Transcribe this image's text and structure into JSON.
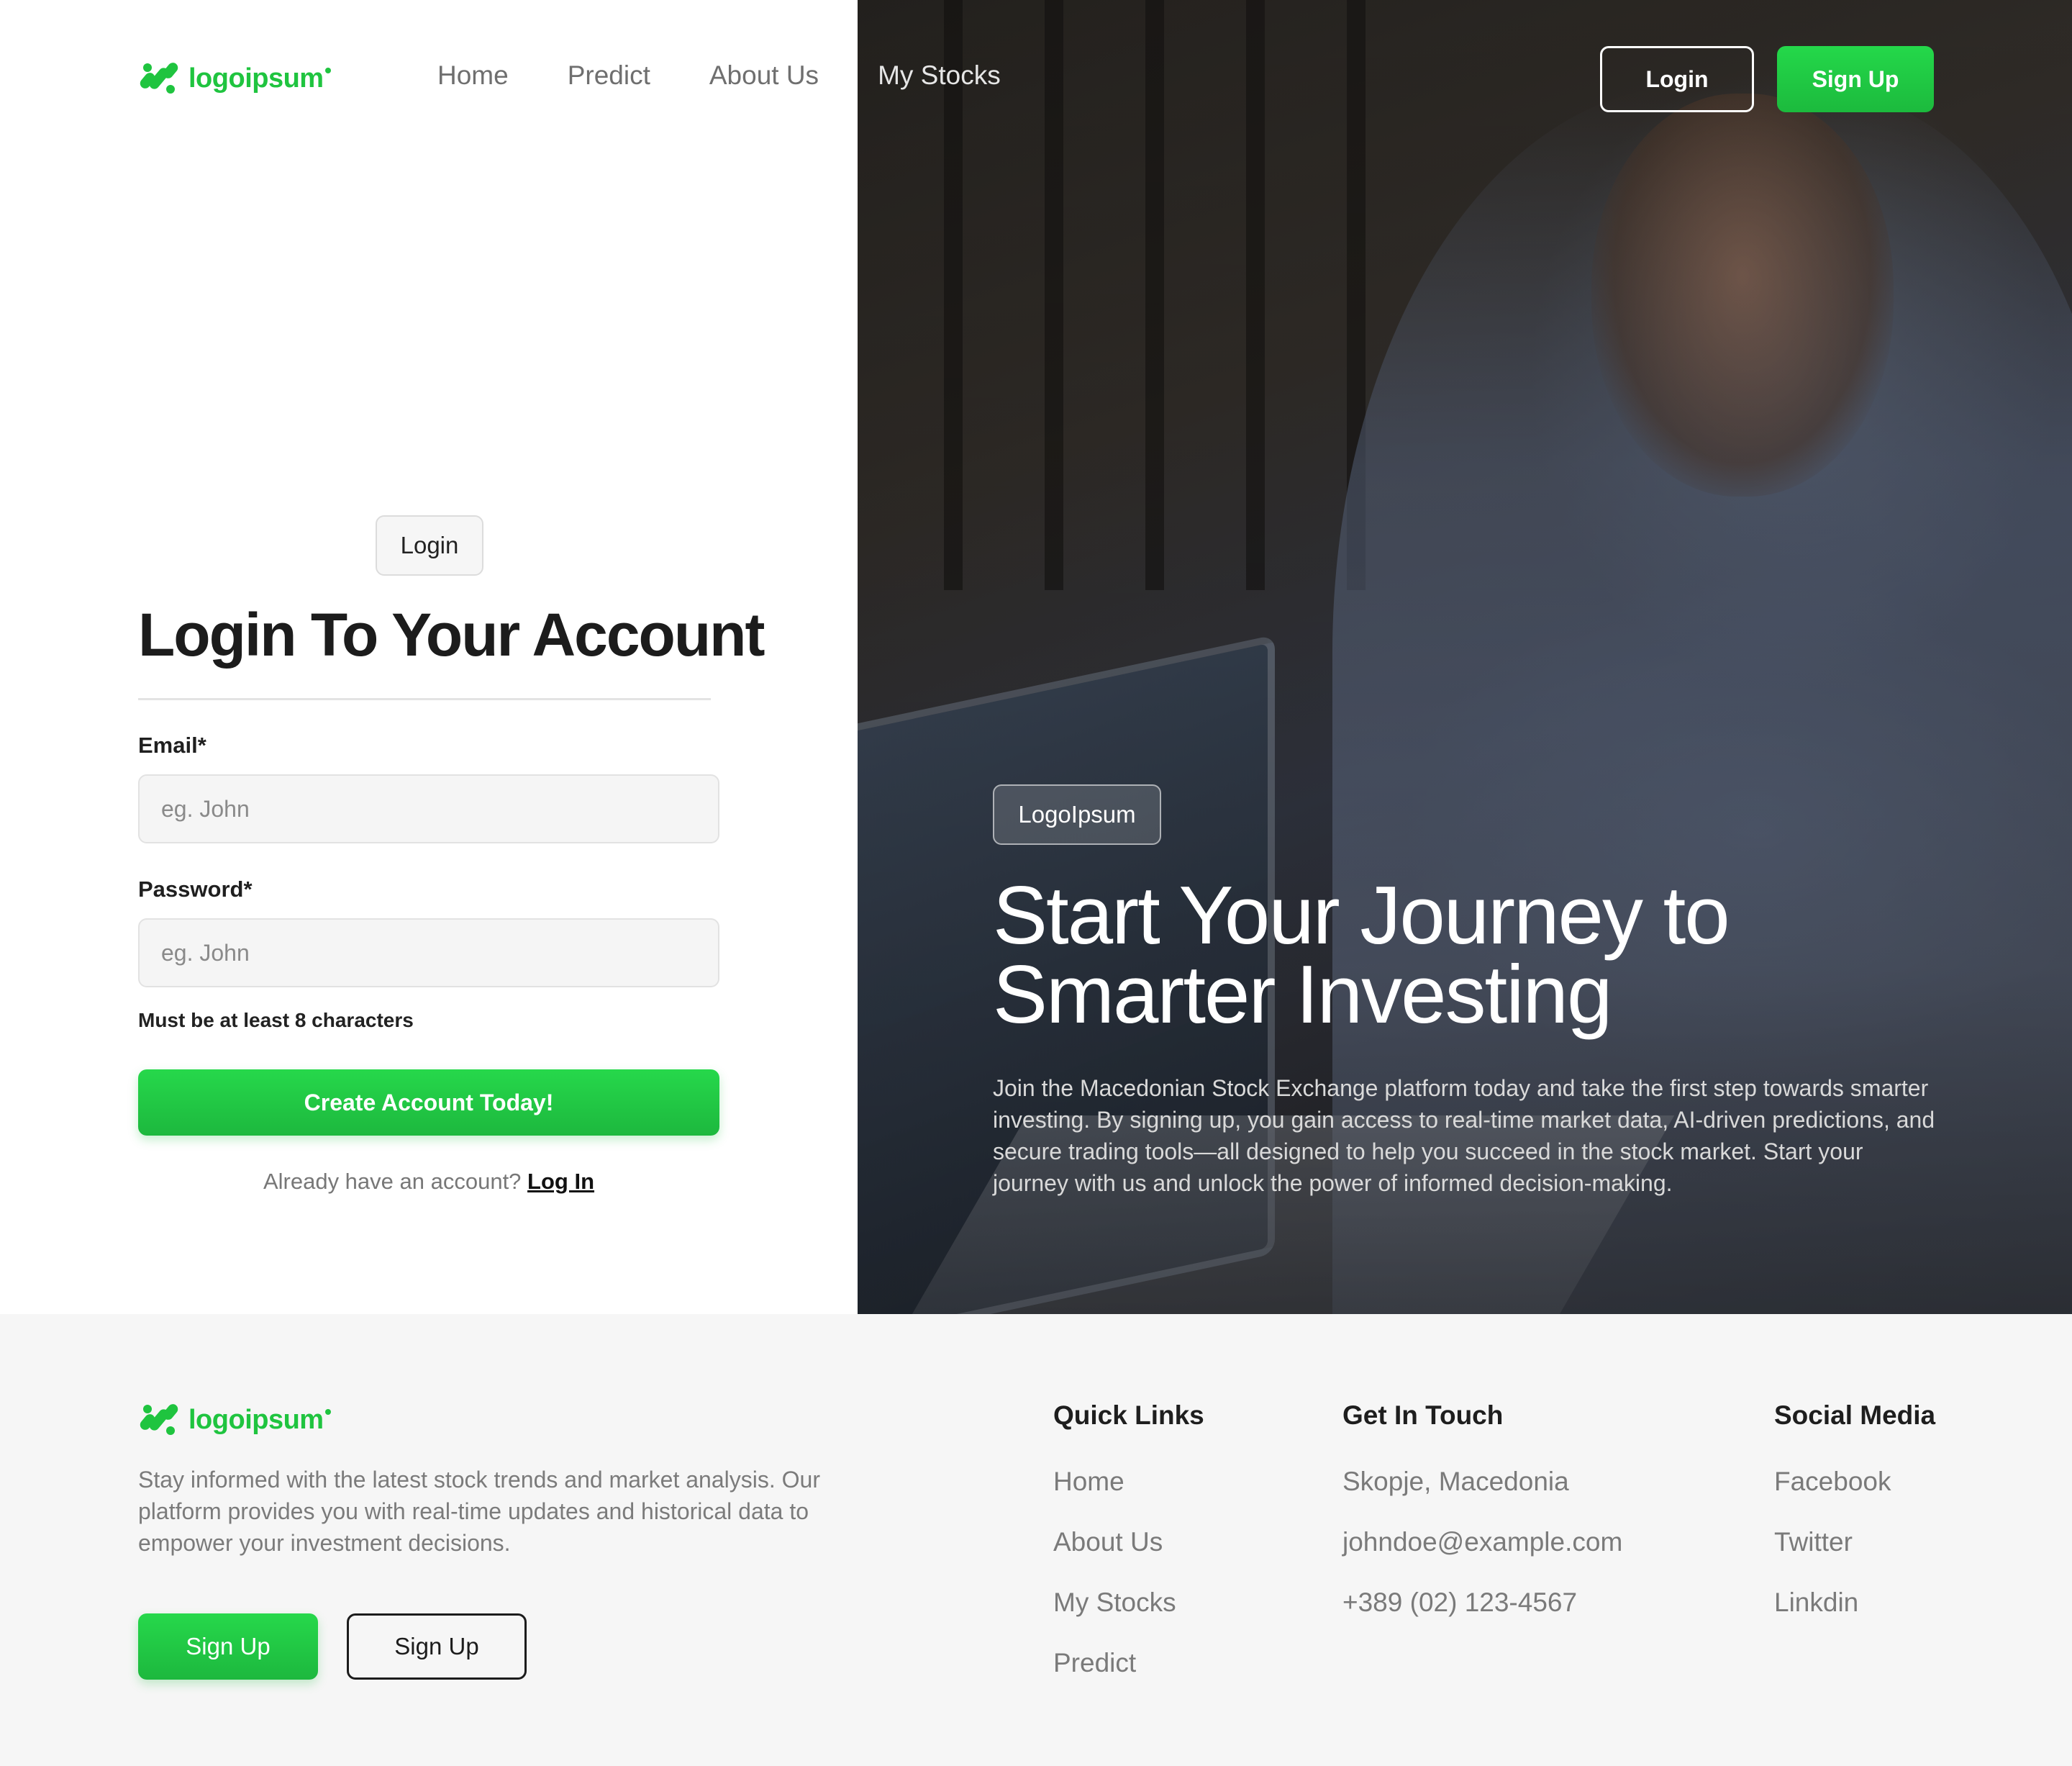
{
  "brand": {
    "name": "logoipsum",
    "color": "#1fc43f"
  },
  "nav": {
    "links": [
      "Home",
      "Predict",
      "About Us",
      "My Stocks"
    ],
    "login_label": "Login",
    "signup_label": "Sign Up"
  },
  "login_form": {
    "badge": "Login",
    "title": "Login To Your Account",
    "email_label": "Email*",
    "email_placeholder": "eg. John",
    "password_label": "Password*",
    "password_placeholder": "eg. John",
    "password_hint": "Must be at least 8 characters",
    "submit_label": "Create Account Today!",
    "already_text": "Already have an account?",
    "login_link": "Log In"
  },
  "hero": {
    "badge": "LogoIpsum",
    "title_line1": "Start Your Journey to",
    "title_line2": "Smarter Investing",
    "description": "Join the Macedonian Stock Exchange platform today and take the first step towards smarter investing. By signing up, you gain access to real-time market data, AI-driven predictions, and secure trading tools—all designed to help you succeed in the stock market. Start your journey with us and unlock the power of informed decision-making."
  },
  "footer": {
    "description": "Stay informed with the latest stock trends and market analysis. Our platform provides you with real-time updates and historical data to empower your investment decisions.",
    "button_primary": "Sign Up",
    "button_secondary": "Sign Up",
    "quick_links": {
      "heading": "Quick Links",
      "items": [
        "Home",
        "About Us",
        "My Stocks",
        "Predict"
      ]
    },
    "get_in_touch": {
      "heading": "Get In Touch",
      "items": [
        "Skopje, Macedonia",
        "johndoe@example.com",
        "+389 (02) 123-4567"
      ]
    },
    "social_media": {
      "heading": "Social Media",
      "items": [
        "Facebook",
        "Twitter",
        "Linkdin"
      ]
    }
  }
}
